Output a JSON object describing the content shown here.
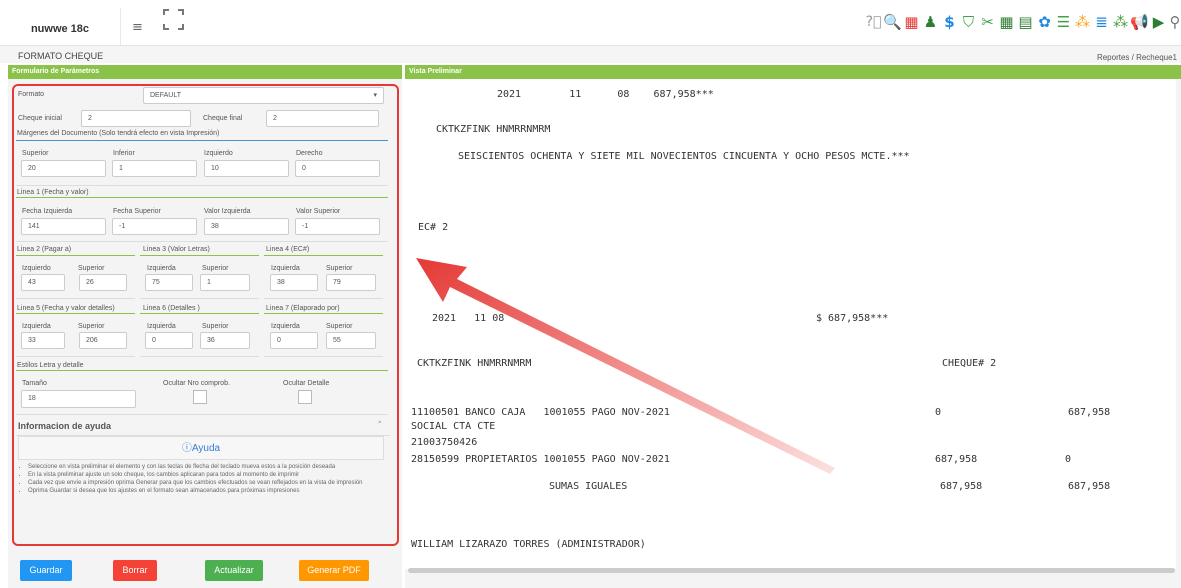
{
  "header": {
    "brand": "nuwwe 18c"
  },
  "page": {
    "title": "FORMATO CHEQUE",
    "breadcrumb": "Reportes  /  Recheque1"
  },
  "panels": {
    "params_title": "Formulario de Parámetros",
    "preview_title": "Vista Preliminar"
  },
  "form": {
    "formato_label": "Formato",
    "formato_value": "DEFAULT",
    "cheque_inicial_label": "Cheque inicial",
    "cheque_inicial_value": "2",
    "cheque_final_label": "Cheque final",
    "cheque_final_value": "2",
    "margenes_title": "Márgenes del Documento (Solo tendrá efecto en vista Impresión)",
    "margenes": [
      {
        "label": "Superior",
        "value": "20"
      },
      {
        "label": "Inferior",
        "value": "1"
      },
      {
        "label": "Izquierdo",
        "value": "10"
      },
      {
        "label": "Derecho",
        "value": "0"
      }
    ],
    "linea1_title": "Linea 1 (Fecha y valor)",
    "linea1": [
      {
        "label": "Fecha Izquierda",
        "value": "141"
      },
      {
        "label": "Fecha Superior",
        "value": "-1"
      },
      {
        "label": "Valor Izquierda",
        "value": "38"
      },
      {
        "label": "Valor Superior",
        "value": "-1"
      }
    ],
    "groups_row1": [
      {
        "title": "Linea 2 (Pagar a)",
        "l1": "Izquierdo",
        "v1": "43",
        "l2": "Superior",
        "v2": "26"
      },
      {
        "title": "Linea 3 (Valor Letras)",
        "l1": "Izquierda",
        "v1": "75",
        "l2": "Superior",
        "v2": "1"
      },
      {
        "title": "Linea 4 (EC#)",
        "l1": "Izquierda",
        "v1": "38",
        "l2": "Superior",
        "v2": "79"
      }
    ],
    "groups_row2": [
      {
        "title": "Linea 5 (Fecha y valor detalles)",
        "l1": "Izquierda",
        "v1": "33",
        "l2": "Superior",
        "v2": "206"
      },
      {
        "title": "Linea 6 (Detalles )",
        "l1": "Izquierda",
        "v1": "0",
        "l2": "Superior",
        "v2": "36"
      },
      {
        "title": "Linea 7 (Elaporado por)",
        "l1": "Izquierda",
        "v1": "0",
        "l2": "Superior",
        "v2": "55"
      }
    ],
    "estilos_title": "Estilos Letra y detalle",
    "tamano_label": "Tamaño",
    "tamano_value": "18",
    "ocultar_nro_label": "Ocultar Nro comprob.",
    "ocultar_detalle_label": "Ocultar Detalle"
  },
  "help": {
    "title": "Informacion de ayuda",
    "box_title": "ⓘAyuda",
    "items": [
      "Seleccione en vista preliminar el elemento y con las teclas de flecha del teclado mueva estos a la posición deseada",
      "En la vista preliminar ajuste un solo cheque, los cambios aplicaran para todos al momento de imprimir",
      "Cada vez que envíe a impresión oprima Generar para que los cambios efectuados se vean reflejados en la vista de impresión",
      "Oprima Guardar si desea que los ajustes en el formato sean almacenados para próximas impresiones"
    ]
  },
  "buttons": {
    "guardar": "Guardar",
    "borrar": "Borrar",
    "actualizar": "Actualizar",
    "pdf": "Generar PDF"
  },
  "colors": {
    "guardar": "#2196f3",
    "borrar": "#f44336",
    "actualizar": "#4caf50",
    "pdf": "#ff9800",
    "panel_header": "#8bc34a",
    "annotation": "#e53935"
  },
  "preview": {
    "date_line": "2021        11      08    687,958***",
    "payee": "CKTKZFINK HNMRRNMRM",
    "amount_words": "SEISCIENTOS OCHENTA Y SIETE MIL NOVECIENTOS CINCUENTA Y OCHO PESOS MCTE.***",
    "ec": "EC# 2",
    "detail_date": "2021   11 08",
    "detail_amount": "$ 687,958***",
    "detail_payee": "CKTKZFINK HNMRRNMRM",
    "cheque_no": "CHEQUE# 2",
    "rows": [
      {
        "desc": "11100501 BANCO CAJA   1001055 PAGO NOV-2021",
        "debit": "0",
        "credit": "687,958"
      },
      {
        "desc": "SOCIAL CTA CTE",
        "debit": "",
        "credit": ""
      },
      {
        "desc": "21003750426",
        "debit": "",
        "credit": ""
      },
      {
        "desc": "28150599 PROPIETARIOS 1001055 PAGO NOV-2021",
        "debit": "687,958",
        "credit": "0"
      }
    ],
    "sumas_label": "SUMAS IGUALES",
    "sumas_debit": "687,958",
    "sumas_credit": "687,958",
    "elaborado": "WILLIAM LIZARAZO TORRES (ADMINISTRADOR)"
  },
  "toolbar_icons": [
    "help-icon",
    "search-doc-icon",
    "calendar-icon",
    "person-icon",
    "dollar-icon",
    "shield-icon",
    "tools-icon",
    "calculator-icon",
    "clipboard-icon",
    "palette-icon",
    "database-icon",
    "grid-icon",
    "list-icon",
    "dots-grid-icon",
    "megaphone-icon",
    "play-icon",
    "search-icon"
  ]
}
